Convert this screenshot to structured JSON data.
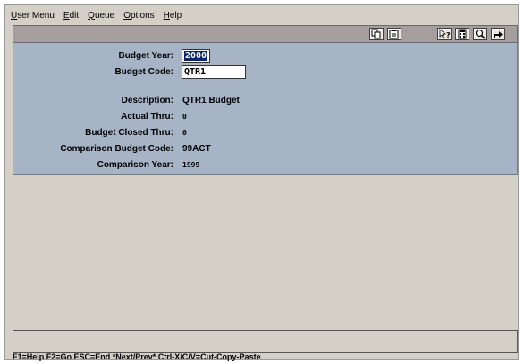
{
  "menu": [
    {
      "u": "U",
      "rest": "ser Menu"
    },
    {
      "u": "E",
      "rest": "dit"
    },
    {
      "u": "Q",
      "rest": "ueue"
    },
    {
      "u": "O",
      "rest": "ptions"
    },
    {
      "u": "H",
      "rest": "elp"
    }
  ],
  "toolbar": {
    "icons": [
      "copy-icon",
      "paste-icon",
      "help-pointer-icon",
      "calculator-icon",
      "search-icon",
      "exit-icon"
    ]
  },
  "form": {
    "budget_year": {
      "label": "Budget Year:",
      "value": "2000"
    },
    "budget_code": {
      "label": "Budget Code:",
      "value": "QTR1"
    },
    "description": {
      "label": "Description:",
      "value": "QTR1 Budget"
    },
    "actual_thru": {
      "label": "Actual Thru:",
      "value": "0"
    },
    "budget_closed_thru": {
      "label": "Budget Closed Thru:",
      "value": "0"
    },
    "comparison_budget_code": {
      "label": "Comparison Budget Code:",
      "value": "99ACT"
    },
    "comparison_year": {
      "label": "Comparison Year:",
      "value": "1999"
    }
  },
  "status": {
    "text": "F1=Help F2=Go ESC=End  *Next/Prev*  Ctrl-X/C/V=Cut-Copy-Paste"
  },
  "colors": {
    "form_bg": "#a6b4c6",
    "toolbar_bg": "#a49e9e",
    "window_bg": "#d4d0c8",
    "selection": "#0a246a"
  }
}
